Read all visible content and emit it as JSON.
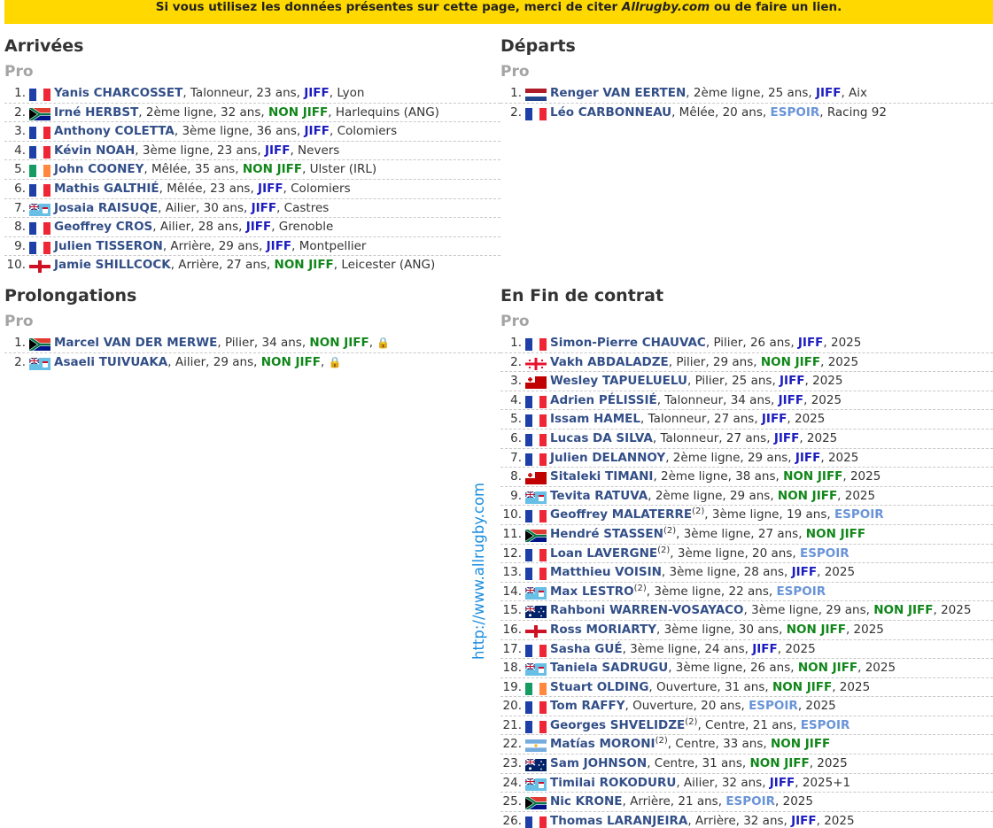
{
  "banner": {
    "before": "Si vous utilisez les données présentes sur cette page, merci de citer ",
    "site": "Allrugby.com",
    "after": " ou de faire un lien."
  },
  "watermark": "http://www.allrugby.com",
  "lock_glyph": "🔒",
  "sections": {
    "arrivees": {
      "title": "Arrivées",
      "sub": "Pro",
      "players": [
        {
          "n": "1.",
          "flag": "fr",
          "name": "Yanis CHARCOSSET",
          "sup": "",
          "details": "Talonneur, 23 ans",
          "status": "JIFF",
          "status_class": "jiff",
          "extra": ", Lyon"
        },
        {
          "n": "2.",
          "flag": "za",
          "name": "Irné HERBST",
          "sup": "",
          "details": "2ème ligne, 32 ans",
          "status": "NON JIFF",
          "status_class": "nonjiff",
          "extra": ", Harlequins (ANG)"
        },
        {
          "n": "3.",
          "flag": "fr",
          "name": "Anthony COLETTA",
          "sup": "",
          "details": "3ème ligne, 36 ans",
          "status": "JIFF",
          "status_class": "jiff",
          "extra": ", Colomiers"
        },
        {
          "n": "4.",
          "flag": "fr",
          "name": "Kévin NOAH",
          "sup": "",
          "details": "3ème ligne, 23 ans",
          "status": "JIFF",
          "status_class": "jiff",
          "extra": ", Nevers"
        },
        {
          "n": "5.",
          "flag": "ie",
          "name": "John COONEY",
          "sup": "",
          "details": "Mêlée, 35 ans",
          "status": "NON JIFF",
          "status_class": "nonjiff",
          "extra": ", Ulster (IRL)"
        },
        {
          "n": "6.",
          "flag": "fr",
          "name": "Mathis GALTHIÉ",
          "sup": "",
          "details": "Mêlée, 23 ans",
          "status": "JIFF",
          "status_class": "jiff",
          "extra": ", Colomiers"
        },
        {
          "n": "7.",
          "flag": "fj",
          "name": "Josaia RAISUQE",
          "sup": "",
          "details": "Ailier, 30 ans",
          "status": "JIFF",
          "status_class": "jiff",
          "extra": ", Castres"
        },
        {
          "n": "8.",
          "flag": "fr",
          "name": "Geoffrey CROS",
          "sup": "",
          "details": "Ailier, 28 ans",
          "status": "JIFF",
          "status_class": "jiff",
          "extra": ", Grenoble"
        },
        {
          "n": "9.",
          "flag": "fr",
          "name": "Julien TISSERON",
          "sup": "",
          "details": "Arrière, 29 ans",
          "status": "JIFF",
          "status_class": "jiff",
          "extra": ", Montpellier"
        },
        {
          "n": "10.",
          "flag": "en",
          "name": "Jamie SHILLCOCK",
          "sup": "",
          "details": "Arrière, 27 ans",
          "status": "NON JIFF",
          "status_class": "nonjiff",
          "extra": ", Leicester (ANG)"
        }
      ]
    },
    "departs": {
      "title": "Départs",
      "sub": "Pro",
      "players": [
        {
          "n": "1.",
          "flag": "nl",
          "name": "Renger VAN EERTEN",
          "sup": "",
          "details": "2ème ligne, 25 ans",
          "status": "JIFF",
          "status_class": "jiff",
          "extra": ", Aix"
        },
        {
          "n": "2.",
          "flag": "fr",
          "name": "Léo CARBONNEAU",
          "sup": "",
          "details": "Mêlée, 20 ans",
          "status": "ESPOIR",
          "status_class": "espoir",
          "extra": ", Racing 92"
        }
      ]
    },
    "prolongations": {
      "title": "Prolongations",
      "sub": "Pro",
      "players": [
        {
          "n": "1.",
          "flag": "za",
          "name": "Marcel VAN DER MERWE",
          "sup": "",
          "details": "Pilier, 34 ans",
          "status": "NON JIFF",
          "status_class": "nonjiff",
          "extra": ",",
          "lock": true
        },
        {
          "n": "2.",
          "flag": "fj",
          "name": "Asaeli TUIVUAKA",
          "sup": "",
          "details": "Ailier, 29 ans",
          "status": "NON JIFF",
          "status_class": "nonjiff",
          "extra": ",",
          "lock": true
        }
      ]
    },
    "fin_contrat": {
      "title": "En Fin de contrat",
      "sub": "Pro",
      "players": [
        {
          "n": "1.",
          "flag": "fr",
          "name": "Simon-Pierre CHAUVAC",
          "sup": "",
          "details": "Pilier, 26 ans",
          "status": "JIFF",
          "status_class": "jiff",
          "extra": ", 2025"
        },
        {
          "n": "2.",
          "flag": "ge",
          "name": "Vakh ABDALADZE",
          "sup": "",
          "details": "Pilier, 29 ans",
          "status": "NON JIFF",
          "status_class": "nonjiff",
          "extra": ", 2025"
        },
        {
          "n": "3.",
          "flag": "to",
          "name": "Wesley TAPUELUELU",
          "sup": "",
          "details": "Pilier, 25 ans",
          "status": "JIFF",
          "status_class": "jiff",
          "extra": ", 2025"
        },
        {
          "n": "4.",
          "flag": "fr",
          "name": "Adrien PÉLISSIÉ",
          "sup": "",
          "details": "Talonneur, 34 ans",
          "status": "JIFF",
          "status_class": "jiff",
          "extra": ", 2025"
        },
        {
          "n": "5.",
          "flag": "fr",
          "name": "Issam HAMEL",
          "sup": "",
          "details": "Talonneur, 27 ans",
          "status": "JIFF",
          "status_class": "jiff",
          "extra": ", 2025"
        },
        {
          "n": "6.",
          "flag": "fr",
          "name": "Lucas DA SILVA",
          "sup": "",
          "details": "Talonneur, 27 ans",
          "status": "JIFF",
          "status_class": "jiff",
          "extra": ", 2025"
        },
        {
          "n": "7.",
          "flag": "fr",
          "name": "Julien DELANNOY",
          "sup": "",
          "details": "2ème ligne, 29 ans",
          "status": "JIFF",
          "status_class": "jiff",
          "extra": ", 2025"
        },
        {
          "n": "8.",
          "flag": "to",
          "name": "Sitaleki TIMANI",
          "sup": "",
          "details": "2ème ligne, 38 ans",
          "status": "NON JIFF",
          "status_class": "nonjiff",
          "extra": ", 2025"
        },
        {
          "n": "9.",
          "flag": "fj",
          "name": "Tevita RATUVA",
          "sup": "",
          "details": "2ème ligne, 29 ans",
          "status": "NON JIFF",
          "status_class": "nonjiff",
          "extra": ", 2025"
        },
        {
          "n": "10.",
          "flag": "fr",
          "name": "Geoffrey MALATERRE",
          "sup": "(2)",
          "details": "3ème ligne, 19 ans",
          "status": "ESPOIR",
          "status_class": "espoir",
          "extra": ""
        },
        {
          "n": "11.",
          "flag": "za",
          "name": "Hendré STASSEN",
          "sup": "(2)",
          "details": "3ème ligne, 27 ans",
          "status": "NON JIFF",
          "status_class": "nonjiff",
          "extra": ""
        },
        {
          "n": "12.",
          "flag": "fr",
          "name": "Loan LAVERGNE",
          "sup": "(2)",
          "details": "3ème ligne, 20 ans",
          "status": "ESPOIR",
          "status_class": "espoir",
          "extra": ""
        },
        {
          "n": "13.",
          "flag": "fr",
          "name": "Matthieu VOISIN",
          "sup": "",
          "details": "3ème ligne, 28 ans",
          "status": "JIFF",
          "status_class": "jiff",
          "extra": ", 2025"
        },
        {
          "n": "14.",
          "flag": "fj",
          "name": "Max LESTRO",
          "sup": "(2)",
          "details": "3ème ligne, 22 ans",
          "status": "ESPOIR",
          "status_class": "espoir",
          "extra": ""
        },
        {
          "n": "15.",
          "flag": "au",
          "name": "Rahboni WARREN-VOSAYACO",
          "sup": "",
          "details": "3ème ligne, 29 ans",
          "status": "NON JIFF",
          "status_class": "nonjiff",
          "extra": ", 2025"
        },
        {
          "n": "16.",
          "flag": "en",
          "name": "Ross MORIARTY",
          "sup": "",
          "details": "3ème ligne, 30 ans",
          "status": "NON JIFF",
          "status_class": "nonjiff",
          "extra": ", 2025"
        },
        {
          "n": "17.",
          "flag": "fr",
          "name": "Sasha GUÉ",
          "sup": "",
          "details": "3ème ligne, 24 ans",
          "status": "JIFF",
          "status_class": "jiff",
          "extra": ", 2025"
        },
        {
          "n": "18.",
          "flag": "fj",
          "name": "Taniela SADRUGU",
          "sup": "",
          "details": "3ème ligne, 26 ans",
          "status": "NON JIFF",
          "status_class": "nonjiff",
          "extra": ", 2025"
        },
        {
          "n": "19.",
          "flag": "ie",
          "name": "Stuart OLDING",
          "sup": "",
          "details": "Ouverture, 31 ans",
          "status": "NON JIFF",
          "status_class": "nonjiff",
          "extra": ", 2025"
        },
        {
          "n": "20.",
          "flag": "fr",
          "name": "Tom RAFFY",
          "sup": "",
          "details": "Ouverture, 20 ans",
          "status": "ESPOIR",
          "status_class": "espoir",
          "extra": ", 2025"
        },
        {
          "n": "21.",
          "flag": "fr",
          "name": "Georges SHVELIDZE",
          "sup": "(2)",
          "details": "Centre, 21 ans",
          "status": "ESPOIR",
          "status_class": "espoir",
          "extra": ""
        },
        {
          "n": "22.",
          "flag": "ar",
          "name": "Matías MORONI",
          "sup": "(2)",
          "details": "Centre, 33 ans",
          "status": "NON JIFF",
          "status_class": "nonjiff",
          "extra": ""
        },
        {
          "n": "23.",
          "flag": "au",
          "name": "Sam JOHNSON",
          "sup": "",
          "details": "Centre, 31 ans",
          "status": "NON JIFF",
          "status_class": "nonjiff",
          "extra": ", 2025"
        },
        {
          "n": "24.",
          "flag": "fj",
          "name": "Timilai ROKODURU",
          "sup": "",
          "details": "Ailier, 32 ans",
          "status": "JIFF",
          "status_class": "jiff",
          "extra": ", 2025+1"
        },
        {
          "n": "25.",
          "flag": "za",
          "name": "Nic KRONE",
          "sup": "",
          "details": "Arrière, 21 ans",
          "status": "ESPOIR",
          "status_class": "espoir",
          "extra": ", 2025"
        },
        {
          "n": "26.",
          "flag": "fr",
          "name": "Thomas LARANJEIRA",
          "sup": "",
          "details": "Arrière, 32 ans",
          "status": "JIFF",
          "status_class": "jiff",
          "extra": ", 2025"
        }
      ]
    }
  }
}
